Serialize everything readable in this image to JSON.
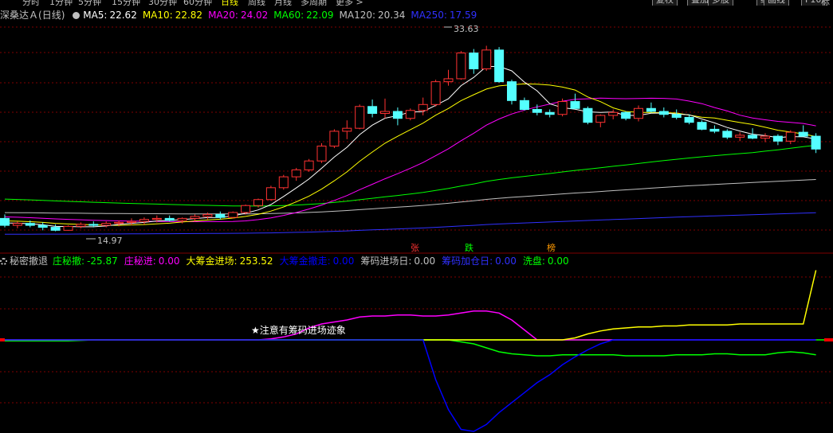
{
  "toolbar": {
    "period_tabs": [
      {
        "label": "分时",
        "active": false
      },
      {
        "label": "1分钟",
        "active": false
      },
      {
        "label": "5分钟",
        "active": false
      },
      {
        "label": "15分钟",
        "active": false
      },
      {
        "label": "30分钟",
        "active": false
      },
      {
        "label": "60分钟",
        "active": false
      },
      {
        "label": "日线",
        "active": true
      },
      {
        "label": "周线",
        "active": false
      },
      {
        "label": "月线",
        "active": false
      },
      {
        "label": "多周期",
        "active": false
      },
      {
        "label": "更多 >",
        "active": false
      }
    ],
    "buttons": [
      "复权",
      "叠加",
      "多股",
      "统计",
      "画线",
      "F10"
    ],
    "right_label": "标"
  },
  "main_legend": {
    "stock_name": "深桑达Ａ",
    "period": "(日线)",
    "ma": [
      {
        "label": "MA5:",
        "value": "22.62",
        "color": "#ffffff"
      },
      {
        "label": "MA10:",
        "value": "22.82",
        "color": "#ffff00"
      },
      {
        "label": "MA20:",
        "value": "24.02",
        "color": "#ff00ff"
      },
      {
        "label": "MA60:",
        "value": "22.09",
        "color": "#00ff00"
      },
      {
        "label": "MA120:",
        "value": "20.34",
        "color": "#c0c0c0"
      },
      {
        "label": "MA250:",
        "value": "17.59",
        "color": "#3030ff"
      }
    ]
  },
  "annotations": {
    "high_price": "33.63",
    "low_price": "14.97",
    "mark_zhang": "张",
    "mark_die": "跌",
    "mark_bang": "榜",
    "sub_note": "★注意有筹码进场迹象"
  },
  "sub_legend": {
    "indicator_name": "秘密撤退",
    "items": [
      {
        "label": "庄秘撤:",
        "value": "-25.87",
        "color": "#00ff00"
      },
      {
        "label": "庄秘进:",
        "value": "0.00",
        "color": "#ff00ff"
      },
      {
        "label": "大筹金进场:",
        "value": "253.52",
        "color": "#ffff00"
      },
      {
        "label": "大筹金撤走:",
        "value": "0.00",
        "color": "#0000ff"
      },
      {
        "label": "筹码进场日:",
        "value": "0.00",
        "color": "#c0c0c0"
      },
      {
        "label": "筹码加仓日:",
        "value": "0.00",
        "color": "#3030ff"
      },
      {
        "label": "洗盘:",
        "value": "0.00",
        "color": "#00ff00"
      }
    ]
  },
  "colors": {
    "up": "#ff3232",
    "down": "#54ffff",
    "grid": "#800000",
    "ma5": "#ffffff",
    "ma10": "#ffff00",
    "ma20": "#ff00ff",
    "ma60": "#00ff00",
    "ma120": "#c0c0c0",
    "ma250": "#3030ff"
  },
  "chart_data": {
    "type": "candlestick",
    "price_range": [
      13.5,
      36
    ],
    "candles": [
      [
        16.2,
        16.6,
        15.3,
        15.5
      ],
      [
        15.5,
        15.9,
        15.2,
        15.7
      ],
      [
        15.7,
        16.0,
        15.3,
        15.5
      ],
      [
        15.5,
        15.8,
        15.0,
        15.3
      ],
      [
        15.3,
        15.6,
        14.9,
        15.0
      ],
      [
        15.0,
        15.5,
        14.97,
        15.4
      ],
      [
        15.4,
        15.8,
        15.2,
        15.6
      ],
      [
        15.6,
        15.9,
        15.3,
        15.5
      ],
      [
        15.5,
        15.9,
        15.3,
        15.7
      ],
      [
        15.7,
        16.0,
        15.4,
        15.8
      ],
      [
        15.8,
        16.2,
        15.5,
        15.9
      ],
      [
        15.9,
        16.3,
        15.6,
        16.1
      ],
      [
        16.1,
        16.5,
        15.8,
        16.2
      ],
      [
        16.2,
        16.5,
        15.9,
        16.0
      ],
      [
        16.0,
        16.3,
        15.7,
        16.2
      ],
      [
        16.2,
        16.6,
        15.9,
        16.4
      ],
      [
        16.4,
        16.8,
        16.1,
        16.6
      ],
      [
        16.6,
        16.9,
        16.1,
        16.3
      ],
      [
        16.3,
        16.9,
        16.2,
        16.8
      ],
      [
        16.8,
        17.6,
        16.6,
        17.5
      ],
      [
        17.5,
        18.2,
        17.3,
        18.1
      ],
      [
        18.1,
        19.5,
        18.0,
        19.3
      ],
      [
        19.3,
        20.6,
        19.1,
        20.4
      ],
      [
        20.4,
        21.3,
        20.0,
        21.1
      ],
      [
        21.1,
        22.2,
        20.9,
        22.0
      ],
      [
        22.0,
        23.8,
        21.8,
        23.5
      ],
      [
        23.5,
        25.2,
        23.3,
        25.0
      ],
      [
        25.0,
        26.1,
        24.2,
        25.3
      ],
      [
        25.3,
        27.7,
        25.2,
        27.5
      ],
      [
        27.5,
        28.2,
        26.4,
        26.8
      ],
      [
        26.8,
        28.3,
        26.3,
        27.0
      ],
      [
        27.0,
        27.4,
        25.6,
        26.3
      ],
      [
        26.3,
        27.3,
        26.1,
        27.1
      ],
      [
        27.1,
        28.4,
        26.6,
        27.7
      ],
      [
        27.7,
        30.2,
        27.5,
        30.0
      ],
      [
        30.0,
        31.2,
        29.6,
        30.3
      ],
      [
        30.3,
        33.1,
        30.2,
        32.9
      ],
      [
        32.9,
        33.3,
        30.8,
        31.3
      ],
      [
        31.3,
        33.63,
        31.1,
        33.2
      ],
      [
        33.2,
        33.5,
        29.9,
        30.0
      ],
      [
        30.0,
        30.2,
        27.7,
        28.1
      ],
      [
        28.1,
        28.4,
        27.1,
        27.2
      ],
      [
        27.2,
        27.7,
        26.6,
        26.9
      ],
      [
        26.9,
        27.2,
        26.4,
        26.7
      ],
      [
        26.7,
        28.3,
        26.5,
        28.0
      ],
      [
        28.0,
        28.8,
        27.5,
        27.3
      ],
      [
        27.3,
        27.5,
        25.7,
        25.9
      ],
      [
        25.9,
        26.7,
        25.4,
        26.6
      ],
      [
        26.6,
        27.2,
        26.2,
        26.9
      ],
      [
        26.9,
        27.0,
        26.1,
        26.3
      ],
      [
        26.3,
        27.6,
        26.0,
        27.3
      ],
      [
        27.3,
        27.9,
        26.9,
        27.0
      ],
      [
        27.0,
        27.4,
        26.4,
        26.7
      ],
      [
        26.7,
        27.2,
        26.2,
        26.4
      ],
      [
        26.4,
        26.7,
        25.7,
        25.9
      ],
      [
        25.9,
        26.1,
        25.1,
        25.2
      ],
      [
        25.2,
        25.6,
        24.8,
        25.0
      ],
      [
        25.0,
        25.2,
        24.2,
        24.4
      ],
      [
        24.4,
        24.9,
        24.0,
        24.6
      ],
      [
        24.6,
        25.3,
        24.2,
        24.3
      ],
      [
        24.3,
        24.8,
        23.9,
        24.5
      ],
      [
        24.5,
        24.7,
        23.6,
        24.0
      ],
      [
        24.0,
        25.1,
        23.7,
        24.9
      ],
      [
        24.9,
        25.6,
        24.5,
        24.5
      ],
      [
        24.5,
        24.8,
        22.8,
        23.2
      ]
    ],
    "sub_series": {
      "zhuang_mi_che": [
        -1,
        -1,
        -1,
        -1,
        -1,
        -1,
        -0.5,
        0,
        0,
        0,
        0,
        0,
        0,
        0,
        0,
        0,
        0,
        0,
        0,
        0,
        0,
        0,
        0,
        0,
        0,
        0,
        0,
        0,
        0,
        0,
        0,
        0,
        0,
        0,
        0,
        0,
        -2,
        -4,
        -8,
        -12,
        -14,
        -15,
        -16,
        -16,
        -15,
        -15,
        -15,
        -15,
        -15,
        -16,
        -16,
        -16,
        -16,
        -15,
        -15,
        -15,
        -14,
        -14,
        -15,
        -15,
        -15,
        -13,
        -12,
        -13,
        -15
      ],
      "zhuang_mi_jin": [
        0,
        0,
        0,
        0,
        0,
        0,
        0,
        0,
        0,
        0,
        0,
        0,
        0,
        0,
        0,
        0,
        0,
        0,
        0,
        0,
        0,
        1,
        3,
        6,
        12,
        16,
        18,
        20,
        23,
        24,
        24,
        25,
        25,
        24,
        24,
        25,
        27,
        29,
        29,
        27,
        20,
        10,
        0,
        0,
        0,
        0,
        0,
        0,
        0,
        0,
        0,
        0,
        0,
        0,
        0,
        0,
        0,
        0,
        0,
        0,
        0,
        0,
        0,
        0,
        0
      ],
      "da_chou_jin_jin": [
        0,
        0,
        0,
        0,
        0,
        0,
        0,
        0,
        0,
        0,
        0,
        0,
        0,
        0,
        0,
        0,
        0,
        0,
        0,
        0,
        0,
        0,
        0,
        0,
        0,
        0,
        0,
        0,
        0,
        0,
        0,
        0,
        0,
        0,
        0,
        0,
        0,
        0,
        0,
        0,
        0,
        0,
        0,
        0,
        0,
        2,
        6,
        9,
        11,
        12,
        13,
        13,
        14,
        14,
        15,
        15,
        15,
        15,
        16,
        16,
        16,
        16,
        16,
        16,
        70
      ],
      "da_chou_jin_che": [
        0,
        0,
        0,
        0,
        0,
        0,
        0,
        0,
        0,
        0,
        0,
        0,
        0,
        0,
        0,
        0,
        0,
        0,
        0,
        0,
        0,
        0,
        0,
        0,
        0,
        0,
        0,
        0,
        0,
        0,
        0,
        0,
        0,
        0,
        -40,
        -70,
        -90,
        -92,
        -85,
        -73,
        -63,
        -53,
        -43,
        -35,
        -25,
        -17,
        -10,
        -4,
        0,
        0,
        0,
        0,
        0,
        0,
        0,
        0,
        0,
        0,
        0,
        0,
        0,
        0,
        0,
        0,
        0
      ]
    }
  }
}
